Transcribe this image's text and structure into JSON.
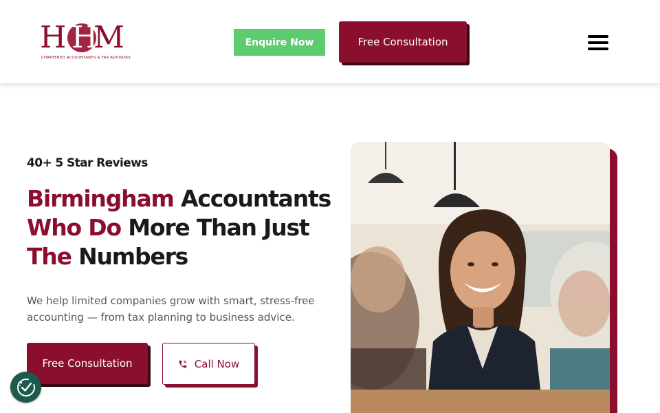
{
  "header": {
    "logo": {
      "letters": "HHM",
      "tagline": "CHARTERED ACCOUNTANTS & TAX ADVISORS"
    },
    "enquire_label": "Enquire Now",
    "consult_label": "Free Consultation",
    "menu_icon": "hamburger-menu-icon"
  },
  "hero": {
    "reviews": "40+ 5 Star Reviews",
    "headline_line1_accent": "Birmingham",
    "headline_line1_rest": " Accountants",
    "headline_line2_accent": "Who Do",
    "headline_line2_rest": " More Than Just",
    "headline_line3_accent": "The",
    "headline_line3_rest": " Numbers",
    "subtext": "We help limited companies grow with smart, stress-free accounting — from tax planning to business advice.",
    "consult_label": "Free Consultation",
    "call_label": "Call Now",
    "call_icon": "phone-icon"
  },
  "photo": {
    "icon": "accountant-meeting-photo"
  },
  "consent": {
    "icon": "cookie-consent-icon"
  },
  "colors": {
    "brand": "#8a0f2e",
    "brand_shadow": "#3a0a12",
    "enquire_green": "#5dcc6f",
    "consent_green": "#1c5a4b"
  }
}
